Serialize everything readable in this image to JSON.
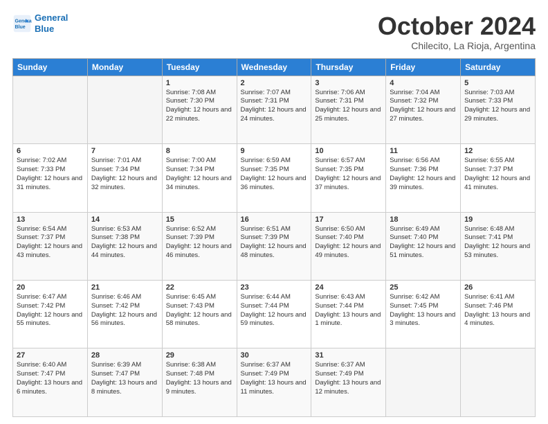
{
  "header": {
    "logo_line1": "General",
    "logo_line2": "Blue",
    "month": "October 2024",
    "location": "Chilecito, La Rioja, Argentina"
  },
  "weekdays": [
    "Sunday",
    "Monday",
    "Tuesday",
    "Wednesday",
    "Thursday",
    "Friday",
    "Saturday"
  ],
  "weeks": [
    [
      {
        "day": "",
        "info": ""
      },
      {
        "day": "",
        "info": ""
      },
      {
        "day": "1",
        "info": "Sunrise: 7:08 AM\nSunset: 7:30 PM\nDaylight: 12 hours and 22 minutes."
      },
      {
        "day": "2",
        "info": "Sunrise: 7:07 AM\nSunset: 7:31 PM\nDaylight: 12 hours and 24 minutes."
      },
      {
        "day": "3",
        "info": "Sunrise: 7:06 AM\nSunset: 7:31 PM\nDaylight: 12 hours and 25 minutes."
      },
      {
        "day": "4",
        "info": "Sunrise: 7:04 AM\nSunset: 7:32 PM\nDaylight: 12 hours and 27 minutes."
      },
      {
        "day": "5",
        "info": "Sunrise: 7:03 AM\nSunset: 7:33 PM\nDaylight: 12 hours and 29 minutes."
      }
    ],
    [
      {
        "day": "6",
        "info": "Sunrise: 7:02 AM\nSunset: 7:33 PM\nDaylight: 12 hours and 31 minutes."
      },
      {
        "day": "7",
        "info": "Sunrise: 7:01 AM\nSunset: 7:34 PM\nDaylight: 12 hours and 32 minutes."
      },
      {
        "day": "8",
        "info": "Sunrise: 7:00 AM\nSunset: 7:34 PM\nDaylight: 12 hours and 34 minutes."
      },
      {
        "day": "9",
        "info": "Sunrise: 6:59 AM\nSunset: 7:35 PM\nDaylight: 12 hours and 36 minutes."
      },
      {
        "day": "10",
        "info": "Sunrise: 6:57 AM\nSunset: 7:35 PM\nDaylight: 12 hours and 37 minutes."
      },
      {
        "day": "11",
        "info": "Sunrise: 6:56 AM\nSunset: 7:36 PM\nDaylight: 12 hours and 39 minutes."
      },
      {
        "day": "12",
        "info": "Sunrise: 6:55 AM\nSunset: 7:37 PM\nDaylight: 12 hours and 41 minutes."
      }
    ],
    [
      {
        "day": "13",
        "info": "Sunrise: 6:54 AM\nSunset: 7:37 PM\nDaylight: 12 hours and 43 minutes."
      },
      {
        "day": "14",
        "info": "Sunrise: 6:53 AM\nSunset: 7:38 PM\nDaylight: 12 hours and 44 minutes."
      },
      {
        "day": "15",
        "info": "Sunrise: 6:52 AM\nSunset: 7:39 PM\nDaylight: 12 hours and 46 minutes."
      },
      {
        "day": "16",
        "info": "Sunrise: 6:51 AM\nSunset: 7:39 PM\nDaylight: 12 hours and 48 minutes."
      },
      {
        "day": "17",
        "info": "Sunrise: 6:50 AM\nSunset: 7:40 PM\nDaylight: 12 hours and 49 minutes."
      },
      {
        "day": "18",
        "info": "Sunrise: 6:49 AM\nSunset: 7:40 PM\nDaylight: 12 hours and 51 minutes."
      },
      {
        "day": "19",
        "info": "Sunrise: 6:48 AM\nSunset: 7:41 PM\nDaylight: 12 hours and 53 minutes."
      }
    ],
    [
      {
        "day": "20",
        "info": "Sunrise: 6:47 AM\nSunset: 7:42 PM\nDaylight: 12 hours and 55 minutes."
      },
      {
        "day": "21",
        "info": "Sunrise: 6:46 AM\nSunset: 7:42 PM\nDaylight: 12 hours and 56 minutes."
      },
      {
        "day": "22",
        "info": "Sunrise: 6:45 AM\nSunset: 7:43 PM\nDaylight: 12 hours and 58 minutes."
      },
      {
        "day": "23",
        "info": "Sunrise: 6:44 AM\nSunset: 7:44 PM\nDaylight: 12 hours and 59 minutes."
      },
      {
        "day": "24",
        "info": "Sunrise: 6:43 AM\nSunset: 7:44 PM\nDaylight: 13 hours and 1 minute."
      },
      {
        "day": "25",
        "info": "Sunrise: 6:42 AM\nSunset: 7:45 PM\nDaylight: 13 hours and 3 minutes."
      },
      {
        "day": "26",
        "info": "Sunrise: 6:41 AM\nSunset: 7:46 PM\nDaylight: 13 hours and 4 minutes."
      }
    ],
    [
      {
        "day": "27",
        "info": "Sunrise: 6:40 AM\nSunset: 7:47 PM\nDaylight: 13 hours and 6 minutes."
      },
      {
        "day": "28",
        "info": "Sunrise: 6:39 AM\nSunset: 7:47 PM\nDaylight: 13 hours and 8 minutes."
      },
      {
        "day": "29",
        "info": "Sunrise: 6:38 AM\nSunset: 7:48 PM\nDaylight: 13 hours and 9 minutes."
      },
      {
        "day": "30",
        "info": "Sunrise: 6:37 AM\nSunset: 7:49 PM\nDaylight: 13 hours and 11 minutes."
      },
      {
        "day": "31",
        "info": "Sunrise: 6:37 AM\nSunset: 7:49 PM\nDaylight: 13 hours and 12 minutes."
      },
      {
        "day": "",
        "info": ""
      },
      {
        "day": "",
        "info": ""
      }
    ]
  ]
}
